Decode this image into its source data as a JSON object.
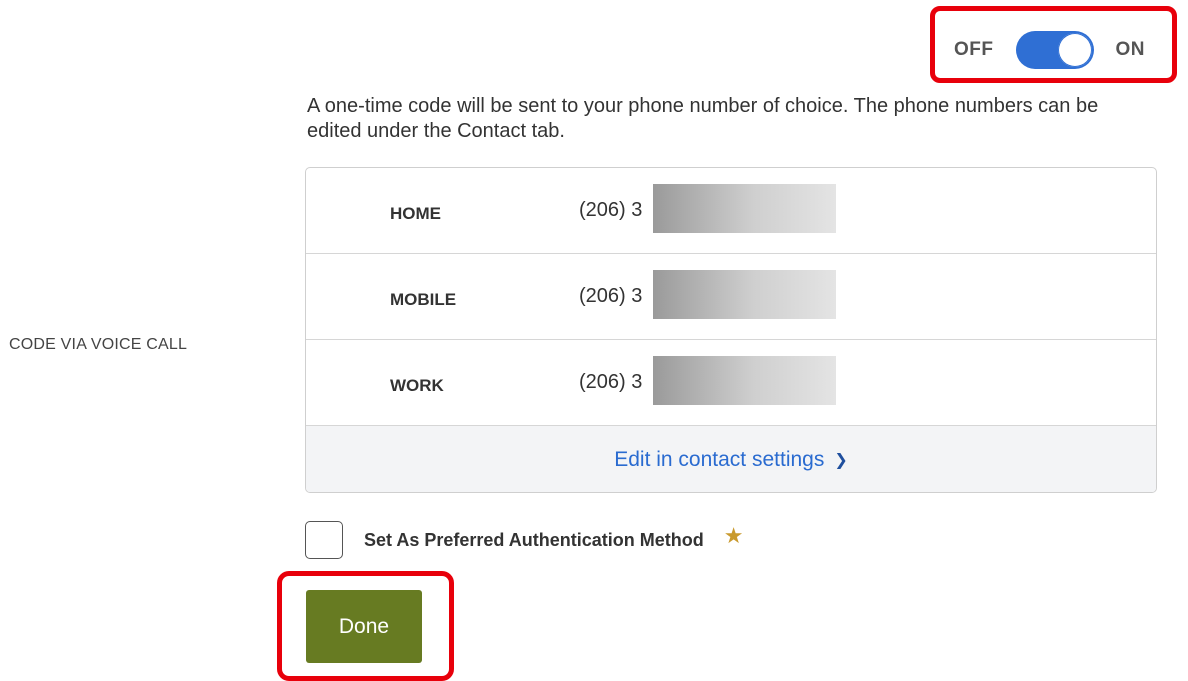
{
  "toggle": {
    "off_label": "OFF",
    "on_label": "ON",
    "state": "on",
    "accent_color": "#2f6fd4"
  },
  "description": "A one-time code will be sent to your phone number of choice. The phone numbers can be edited under the Contact tab.",
  "side_label": "CODE VIA VOICE CALL",
  "phones": [
    {
      "type": "HOME",
      "number": "(206) 3"
    },
    {
      "type": "MOBILE",
      "number": "(206) 3"
    },
    {
      "type": "WORK",
      "number": "(206) 3"
    }
  ],
  "edit_link": {
    "label": "Edit in contact settings",
    "icon": "chevron-right-icon"
  },
  "preferred": {
    "label": "Set As Preferred Authentication Method",
    "checked": false,
    "icon": "star-icon",
    "icon_color": "#c99a2e"
  },
  "done_button": {
    "label": "Done",
    "color": "#677b22"
  },
  "highlight_color": "#e8000b"
}
